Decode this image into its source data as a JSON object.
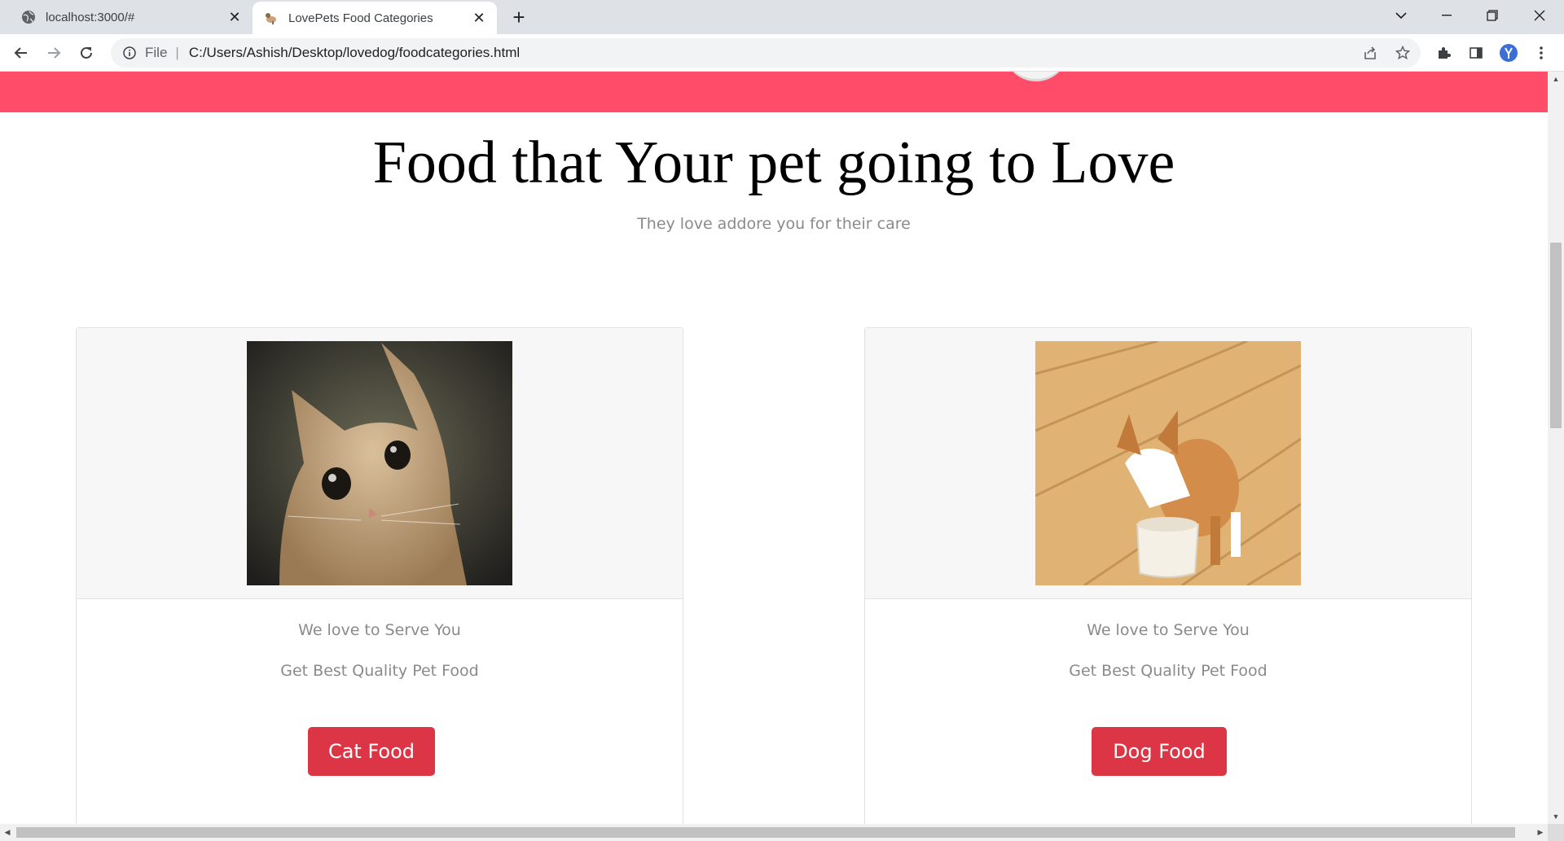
{
  "browser": {
    "tabs": [
      {
        "title": "localhost:3000/#",
        "active": false,
        "icon": "globe-icon"
      },
      {
        "title": "LovePets Food Categories",
        "active": true,
        "icon": "dog-favicon-icon"
      }
    ],
    "address": {
      "scheme": "File",
      "url": "C:/Users/Ashish/Desktop/lovedog/foodcategories.html"
    }
  },
  "page": {
    "title": "Food that Your pet going to Love",
    "subtitle": "They love addore you for their care",
    "accent_color": "#ff4c68",
    "cards": [
      {
        "image": "cat-photo",
        "line1": "We love to Serve You",
        "line2": "Get Best Quality Pet Food",
        "button": "Cat Food"
      },
      {
        "image": "dog-photo",
        "line1": "We love to Serve You",
        "line2": "Get Best Quality Pet Food",
        "button": "Dog Food"
      }
    ],
    "button_color": "#dc3545"
  }
}
